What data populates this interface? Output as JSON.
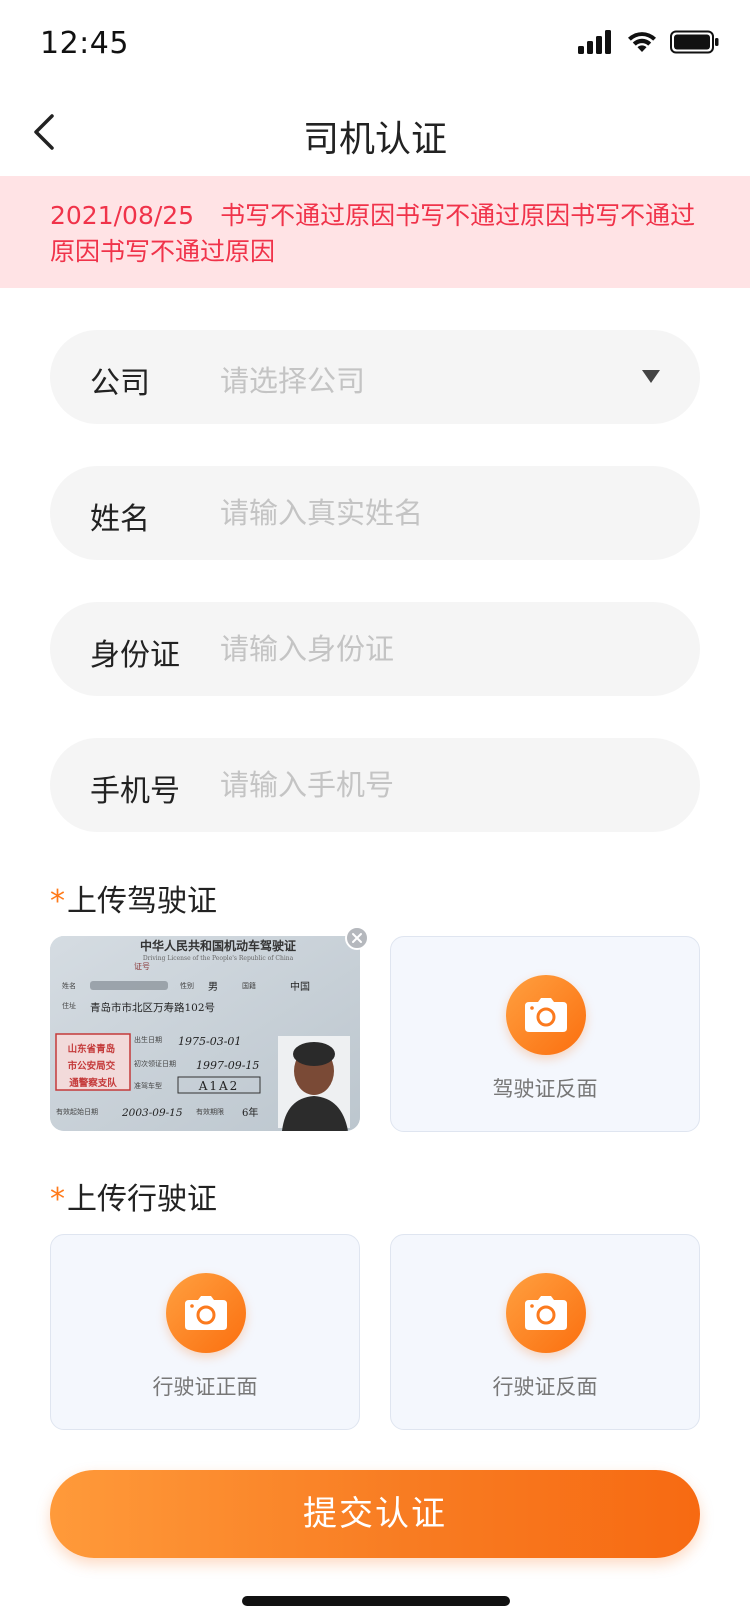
{
  "status_bar": {
    "time": "12:45",
    "icons": [
      "signal-icon",
      "wifi-icon",
      "battery-icon"
    ]
  },
  "nav": {
    "back_icon": "chevron-left-icon",
    "title": "司机认证"
  },
  "banner": {
    "date": "2021/08/25",
    "message": "书写不通过原因书写不通过原因书写不通过原因书写不通过原因",
    "color": "#f0334a",
    "background": "#ffe3e5"
  },
  "form": {
    "company": {
      "label": "公司",
      "placeholder": "请选择公司",
      "value": ""
    },
    "name": {
      "label": "姓名",
      "placeholder": "请输入真实姓名",
      "value": ""
    },
    "id_card": {
      "label": "身份证",
      "placeholder": "请输入身份证",
      "value": ""
    },
    "phone": {
      "label": "手机号",
      "placeholder": "请输入手机号",
      "value": ""
    }
  },
  "uploads": {
    "driver_license": {
      "required_mark": "*",
      "title": "上传驾驶证",
      "front": {
        "status": "uploaded",
        "remove_icon": "close-icon",
        "card": {
          "header": "中华人民共和国机动车驾驶证",
          "header_en": "Driving License of the People's Republic of China",
          "cert_no": "证号",
          "name_label": "姓名",
          "gender_label": "性别",
          "gender": "男",
          "nationality_label": "国籍",
          "nationality": "中国",
          "address_label": "住址",
          "address": "青岛市市北区万寿路102号",
          "dob_label": "出生日期",
          "dob": "1975-03-01",
          "issue_label": "初次领证日期",
          "issue": "1997-09-15",
          "class_label": "准驾车型",
          "class": "A1A2",
          "valid_from_label": "有效起始日期",
          "valid_from": "2003-09-15",
          "valid_for_label": "有效期限",
          "valid_for": "6年",
          "stamp": "山东省青岛市公安局交通警察支队"
        }
      },
      "back": {
        "label": "驾驶证反面",
        "icon": "camera-icon"
      }
    },
    "vehicle_license": {
      "required_mark": "*",
      "title": "上传行驶证",
      "front": {
        "label": "行驶证正面",
        "icon": "camera-icon"
      },
      "back": {
        "label": "行驶证反面",
        "icon": "camera-icon"
      }
    }
  },
  "submit": {
    "label": "提交认证"
  },
  "colors": {
    "accent": "#f87c22",
    "accent_light": "#ffa040",
    "field_bg": "#f5f5f5",
    "upload_bg": "#f4f7fd"
  }
}
